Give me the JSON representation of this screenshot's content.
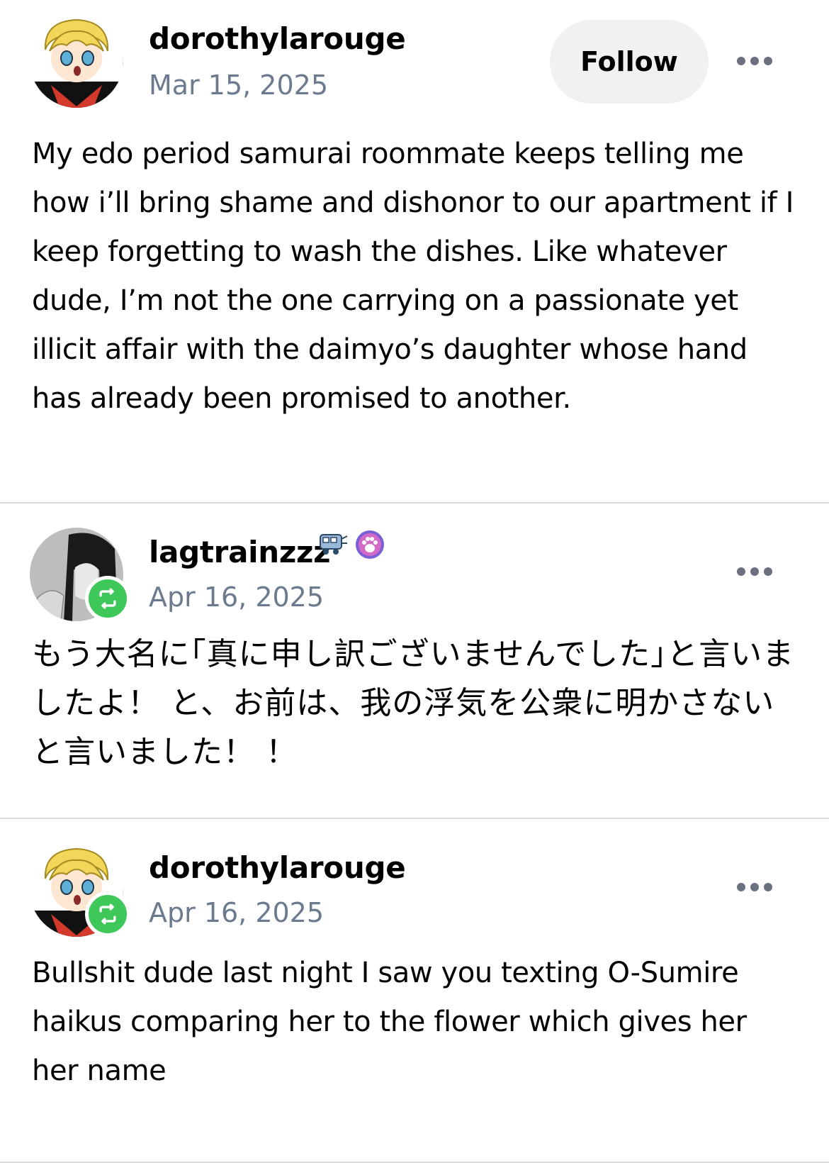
{
  "posts": [
    {
      "username": "dorothylarouge",
      "date": "Mar 15, 2025",
      "follow_label": "Follow",
      "reblog": false,
      "text": "My edo period samurai roommate keeps telling me how i’ll bring shame and dishonor to our apartment if I keep forgetting to wash the dishes. Like whatever dude, I’m not the one carrying on a passionate yet illicit affair with the daimyo’s daughter whose hand has already been promised to another."
    },
    {
      "username": "lagtrainzzz",
      "date": "Apr 16, 2025",
      "reblog": true,
      "badges": [
        "train-badge-icon",
        "paw-badge-icon"
      ],
      "text": "もう大名に｢真に申し訳ございませんでした｣と言いましたよ！ と、お前は、我の浮気を公衆に明かさないと言いました！ ！"
    },
    {
      "username": "dorothylarouge",
      "date": "Apr 16, 2025",
      "reblog": true,
      "text": "Bullshit dude last night I saw you texting O-Sumire haikus comparing her to the flower which gives her her name"
    }
  ],
  "colors": {
    "date": "#6b7a8e",
    "reblog_badge": "#3ec85a",
    "follow_bg": "#f0f1f2",
    "divider": "#dcdcdc"
  }
}
